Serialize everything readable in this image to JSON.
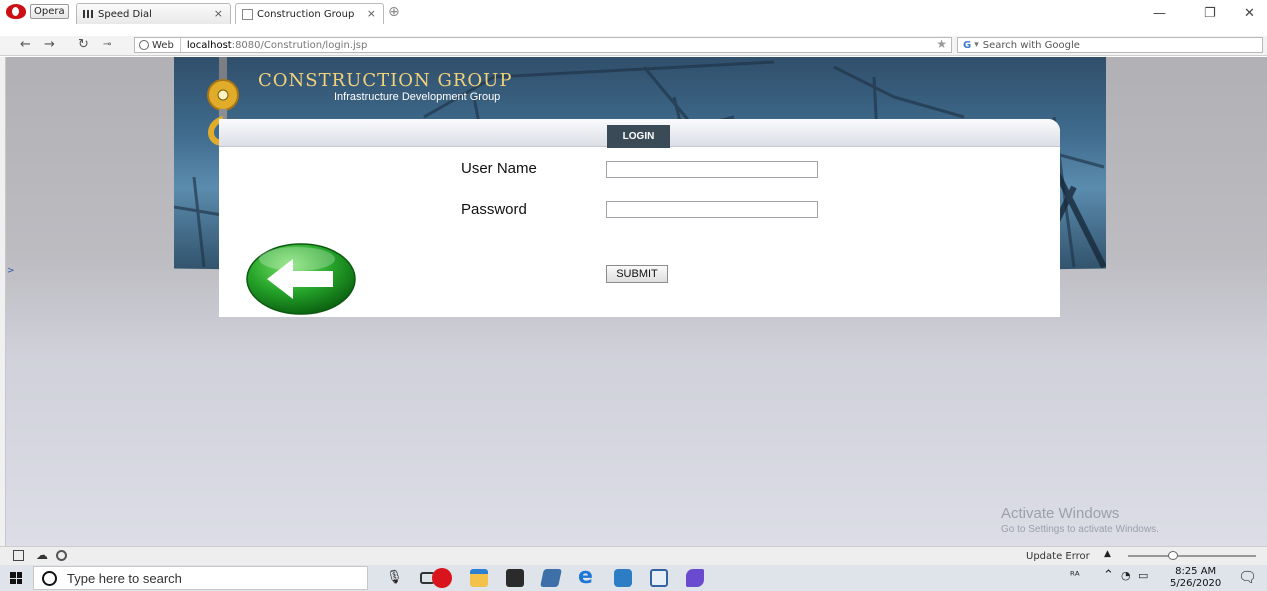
{
  "browser": {
    "menu_label": "Opera",
    "tabs": [
      {
        "label": "Speed Dial"
      },
      {
        "label": "Construction Group"
      }
    ],
    "web_badge": "Web",
    "url_host": "localhost",
    "url_rest": ":8080/Constrution/login.jsp",
    "search_placeholder": "Search with Google"
  },
  "header": {
    "title": "CONSTRUCTION GROUP",
    "subtitle": "Infrastructure Development Group"
  },
  "login": {
    "tab_label": "LOGIN",
    "username_label": "User Name",
    "username_value": "",
    "password_label": "Password",
    "password_value": "",
    "submit_label": "SUBMIT"
  },
  "sidebar_mark": ">",
  "watermark": {
    "title": "Activate Windows",
    "subtitle": "Go to Settings to activate Windows."
  },
  "statusbar": {
    "update_text": "Update Error",
    "zoom_level": 0.35
  },
  "taskbar": {
    "search_placeholder": "Type here to search",
    "time": "8:25 AM",
    "date": "5/26/2020"
  },
  "colors": {
    "login_tab": "#3a4a56",
    "brand_gold": "#f2d27a",
    "opera_red": "#cc0f16"
  }
}
